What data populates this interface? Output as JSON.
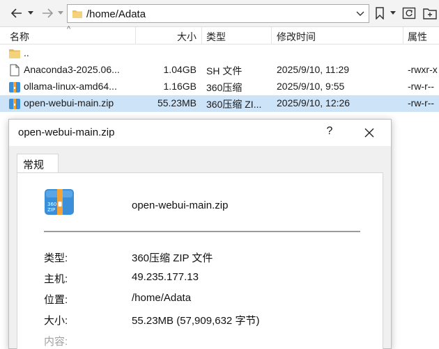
{
  "toolbar": {
    "path": "/home/Adata",
    "icons": [
      "back-arrow-icon",
      "dropdown-icon",
      "forward-arrow-icon",
      "folder-icon",
      "bookmark-icon",
      "refresh-icon",
      "new-folder-icon"
    ]
  },
  "columns": {
    "name": "名称",
    "size": "大小",
    "type": "类型",
    "modified": "修改时间",
    "attributes": "属性"
  },
  "files": [
    {
      "icon": "folder-icon",
      "name": "..",
      "size": "",
      "type": "",
      "modified": "",
      "attributes": ""
    },
    {
      "icon": "document-icon",
      "name": "Anaconda3-2025.06...",
      "size": "1.04GB",
      "type": "SH 文件",
      "modified": "2025/9/10, 11:29",
      "attributes": "-rwxr-x"
    },
    {
      "icon": "zip-archive-icon",
      "name": "ollama-linux-amd64...",
      "size": "1.16GB",
      "type": "360压缩",
      "modified": "2025/9/10, 9:55",
      "attributes": "-rw-r--"
    },
    {
      "icon": "zip-archive-icon",
      "name": "open-webui-main.zip",
      "size": "55.23MB",
      "type": "360压缩 ZI...",
      "modified": "2025/9/10, 12:26",
      "attributes": "-rw-r--"
    }
  ],
  "dialog": {
    "title": "open-webui-main.zip",
    "help": "?",
    "tab": "常规",
    "file_name": "open-webui-main.zip",
    "props": [
      {
        "label": "类型:",
        "value": "360压缩 ZIP 文件"
      },
      {
        "label": "主机:",
        "value": "49.235.177.13"
      },
      {
        "label": "位置:",
        "value": "/home/Adata"
      },
      {
        "label": "大小:",
        "value": "55.23MB (57,909,632 字节)"
      },
      {
        "label": "内容:",
        "value": ""
      }
    ]
  },
  "colors": {
    "selection": "#cde3f7",
    "folder": "#f0c35a",
    "zip_blue": "#3b8fd9",
    "zip_orange": "#f2a33a"
  }
}
